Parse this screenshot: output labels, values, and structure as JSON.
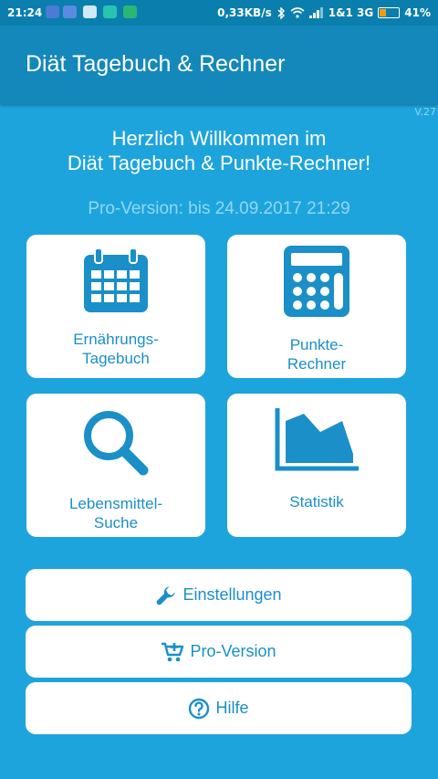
{
  "status_bar": {
    "time": "21:24",
    "net_speed": "0,33KB/s",
    "carrier": "1&1 3G",
    "battery": "41%",
    "battery_level": 0.41
  },
  "app": {
    "title": "Diät Tagebuch & Rechner",
    "version": "V.27"
  },
  "welcome": {
    "line1": "Herzlich Willkommen im",
    "line2": "Diät Tagebuch & Punkte-Rechner!"
  },
  "pro_status": "Pro-Version: bis 24.09.2017 21:29",
  "tiles": [
    {
      "label": "Ernährungs-\nTagebuch",
      "icon": "calendar-icon"
    },
    {
      "label": "Punkte-\nRechner",
      "icon": "calculator-icon"
    },
    {
      "label": "Lebensmittel-\nSuche",
      "icon": "search-icon"
    },
    {
      "label": "Statistik",
      "icon": "area-chart-icon"
    }
  ],
  "buttons": [
    {
      "label": "Einstellungen",
      "icon": "wrench-icon"
    },
    {
      "label": "Pro-Version",
      "icon": "cart-plus-icon"
    },
    {
      "label": "Hilfe",
      "icon": "question-circle-icon"
    }
  ],
  "colors": {
    "background": "#1ea4dc",
    "app_bar": "#1488bb",
    "status_bar": "#0a7fad",
    "accent": "#1a8fc8",
    "pro_text": "#8fd8f5"
  }
}
